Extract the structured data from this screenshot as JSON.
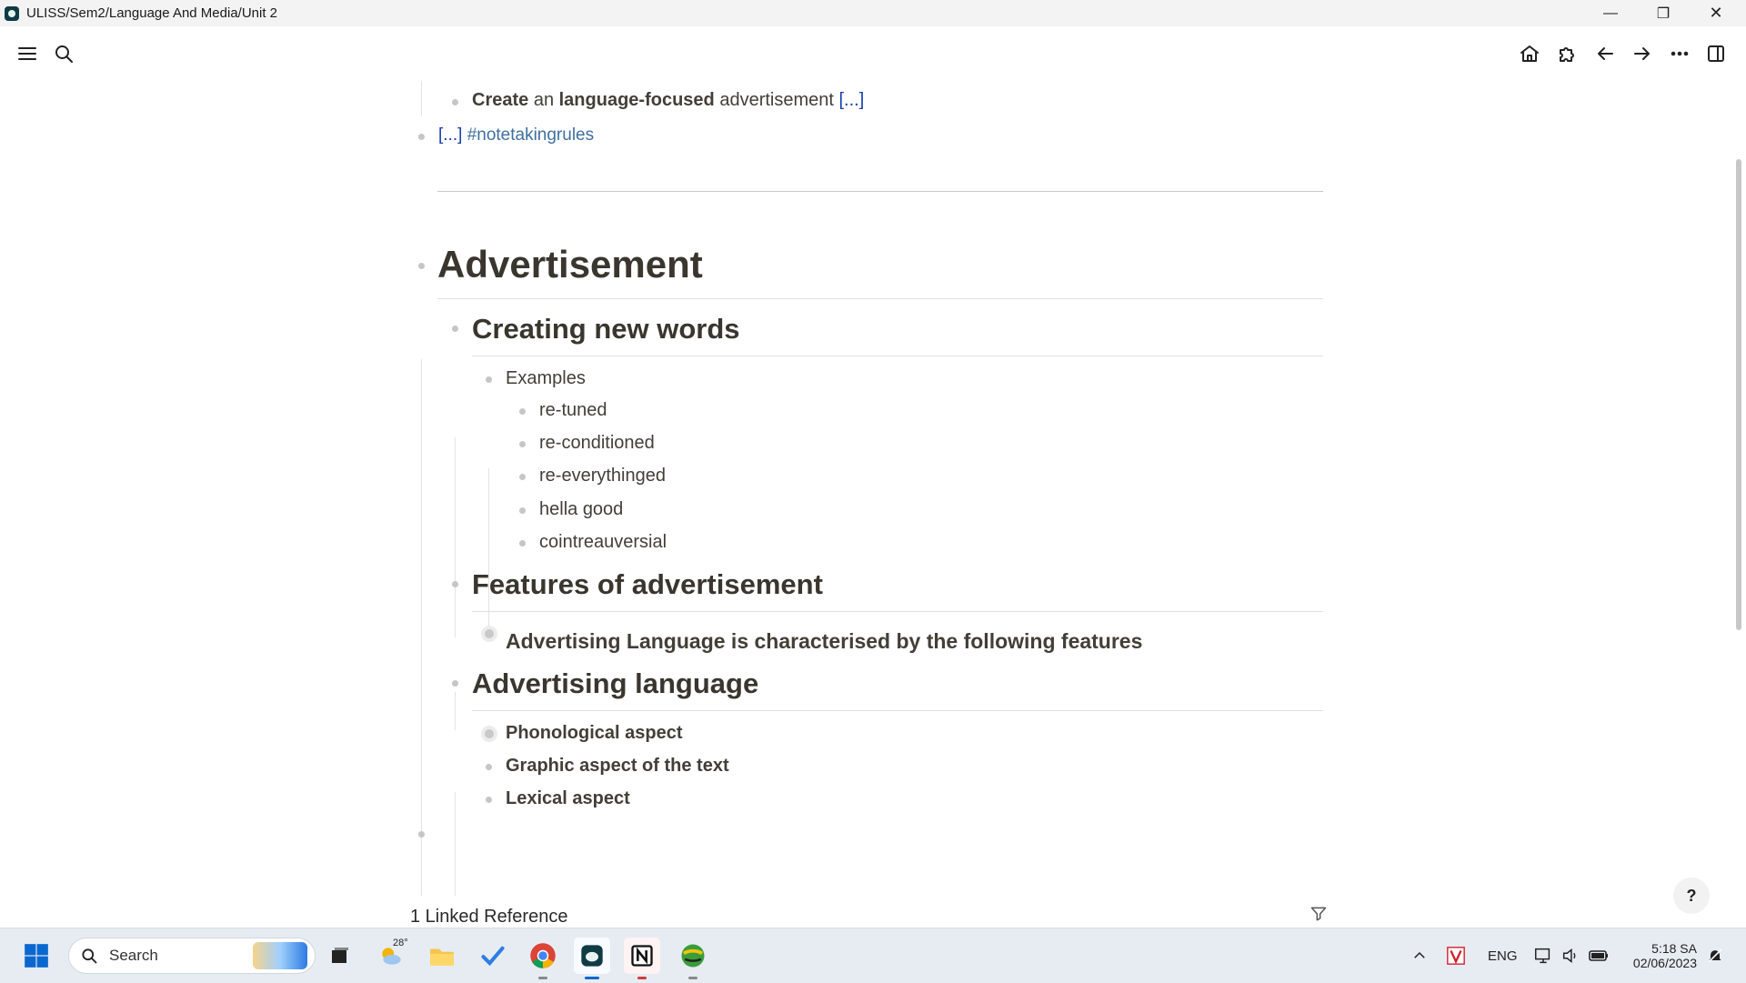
{
  "window": {
    "title": "ULISS/Sem2/Language And Media/Unit 2",
    "controls": {
      "minimize": "—",
      "maximize": "❐",
      "close": "✕"
    }
  },
  "toolbar": {
    "left_icons": [
      "menu-icon",
      "search-icon"
    ],
    "right_icons": [
      "home-icon",
      "puzzle-icon",
      "arrow-left-icon",
      "arrow-right-icon",
      "more-icon",
      "sidebar-toggle-icon"
    ]
  },
  "page": {
    "top_item": {
      "parts": [
        "Create",
        " an ",
        "language-focused",
        " advertisement ",
        "[...]"
      ]
    },
    "rules_item": {
      "ellipsis": "[...]",
      "tag": "#notetakingrules"
    },
    "heading": "Advertisement",
    "sections": [
      {
        "title": "Creating new words",
        "group_label": "Examples",
        "items": [
          "re-tuned",
          "re-conditioned",
          "re-everythinged",
          "hella good",
          "cointreauversial"
        ]
      },
      {
        "title": "Features of advertisement",
        "items": [
          "Advertising Language is characterised by the following features"
        ]
      },
      {
        "title": "Advertising language",
        "items": [
          "Phonological aspect",
          "Graphic aspect of the text",
          "Lexical aspect"
        ]
      }
    ],
    "linked_references": "1 Linked Reference",
    "help": "?"
  },
  "taskbar": {
    "search_placeholder": "Search",
    "weather_temp": "28°",
    "language": "ENG",
    "time": "5:18 SA",
    "date": "02/06/2023"
  }
}
